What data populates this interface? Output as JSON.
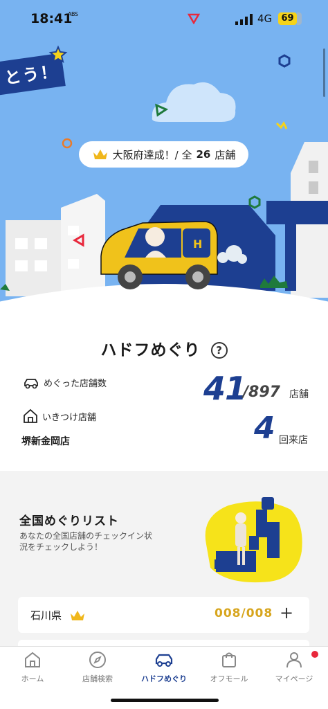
{
  "status": {
    "time": "18:41",
    "small_icon_text": "ABS",
    "network": "4G",
    "battery": "69"
  },
  "hero": {
    "banner_text": "とう！",
    "achievement_text": "大阪府達成！/ 全",
    "achievement_count": "26",
    "achievement_unit": "店舗"
  },
  "main": {
    "title": "ハドフめぐり",
    "help": "?",
    "visited_label": "めぐった店舗数",
    "visited_count": "41",
    "visited_total": "/897",
    "visited_unit": "店舗",
    "favorite_label": "いきつけ店舗",
    "favorite_store": "堺新金岡店",
    "favorite_count": "4",
    "favorite_unit": "回来店"
  },
  "list": {
    "title": "全国めぐりリスト",
    "description": "あなたの全国店舗のチェックイン状況をチェックしよう！",
    "items": [
      {
        "name": "石川県",
        "count": "008/008",
        "action": "+"
      }
    ]
  },
  "nav": {
    "items": [
      {
        "label": "ホーム"
      },
      {
        "label": "店舗検索"
      },
      {
        "label": "ハドフめぐり"
      },
      {
        "label": "オフモール"
      },
      {
        "label": "マイページ"
      }
    ]
  },
  "colors": {
    "navy": "#1d3f91",
    "sky": "#78b3f1",
    "gold": "#d7a51d",
    "yellow": "#f6d31a"
  }
}
